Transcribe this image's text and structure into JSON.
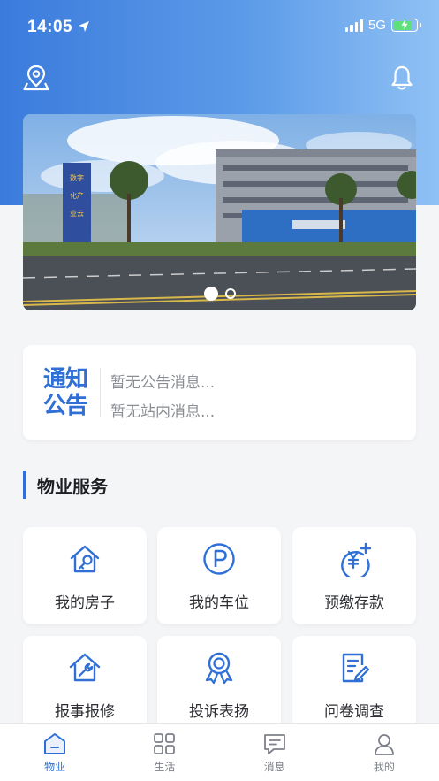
{
  "status_bar": {
    "time": "14:05",
    "network": "5G",
    "battery_level": 0.8
  },
  "header": {
    "location_icon": "location-pin-icon",
    "bell_icon": "bell-icon"
  },
  "banner": {
    "sign_text": "数字化产业云联合创新中心",
    "slides_total": 2,
    "active_slide": 1
  },
  "notice": {
    "badge_line1": "通知",
    "badge_line2": "公告",
    "announcement": "暂无公告消息...",
    "station_message": "暂无站内消息..."
  },
  "services": {
    "title": "物业服务",
    "items": [
      {
        "label": "我的房子",
        "icon": "house-key-icon"
      },
      {
        "label": "我的车位",
        "icon": "parking-icon"
      },
      {
        "label": "预缴存款",
        "icon": "yuan-deposit-icon"
      },
      {
        "label": "报事报修",
        "icon": "house-repair-icon"
      },
      {
        "label": "投诉表扬",
        "icon": "award-ribbon-icon"
      },
      {
        "label": "问卷调查",
        "icon": "survey-edit-icon"
      }
    ]
  },
  "tabbar": {
    "tabs": [
      {
        "label": "物业",
        "icon": "home-icon",
        "active": true
      },
      {
        "label": "生活",
        "icon": "grid-icon",
        "active": false
      },
      {
        "label": "消息",
        "icon": "chat-icon",
        "active": false
      },
      {
        "label": "我的",
        "icon": "user-icon",
        "active": false
      }
    ]
  },
  "colors": {
    "primary": "#2f6fd6",
    "header_start": "#3b7bdc",
    "header_end": "#8fc1f4"
  }
}
